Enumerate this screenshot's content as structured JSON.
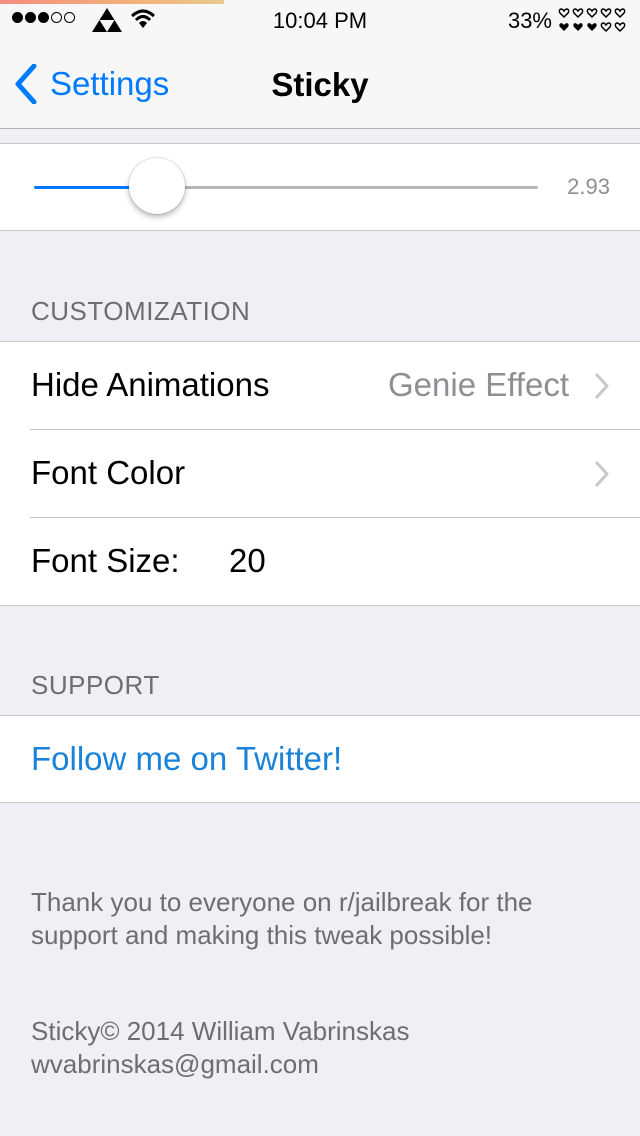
{
  "status_bar": {
    "time": "10:04 PM",
    "battery_percent": "33%",
    "signal_bars_filled": 3,
    "signal_bars_total": 5
  },
  "nav": {
    "back_label": "Settings",
    "title": "Sticky"
  },
  "slider": {
    "value_label": "2.93",
    "fill_fraction": 0.25
  },
  "customization": {
    "header": "CUSTOMIZATION",
    "rows": [
      {
        "label": "Hide Animations",
        "detail": "Genie Effect"
      },
      {
        "label": "Font Color",
        "detail": ""
      },
      {
        "label": "Font Size:",
        "value": "20"
      }
    ]
  },
  "support": {
    "header": "SUPPORT",
    "link_label": "Follow me on Twitter!"
  },
  "footer": {
    "thanks": "Thank you to everyone on r/jailbreak for the support and making this tweak possible!",
    "copyright": "Sticky© 2014 William Vabrinskas",
    "email": "wvabrinskas@gmail.com"
  },
  "colors": {
    "accent": "#007aff",
    "link": "#1a82d8",
    "background": "#efeff4",
    "secondary_text": "#8e8e93"
  },
  "icons": [
    "back-chevron-icon",
    "triforce-icon",
    "wifi-icon",
    "hearts-icon",
    "chevron-right-icon"
  ]
}
